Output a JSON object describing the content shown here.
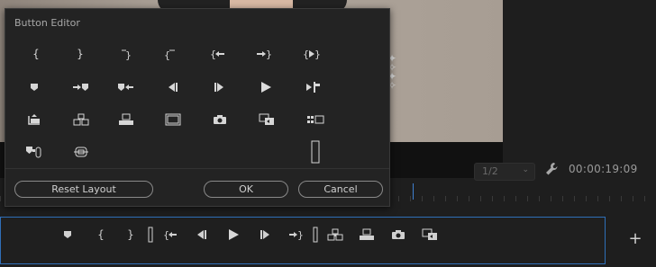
{
  "dialog": {
    "title": "Button Editor",
    "buttons": {
      "reset_layout": "Reset Layout",
      "ok": "OK",
      "cancel": "Cancel"
    },
    "grid_icons": [
      [
        "mark-in-icon",
        "mark-out-icon",
        "clear-in-icon",
        "clear-out-icon",
        "go-to-in-icon",
        "go-to-out-icon",
        "play-in-to-out-icon"
      ],
      [
        "add-marker-icon",
        "go-to-next-marker-icon",
        "go-to-previous-marker-icon",
        "step-back-icon",
        "step-forward-icon",
        "play-icon",
        "play-around-icon"
      ],
      [
        "lift-icon",
        "insert-icon",
        "overwrite-icon",
        "safe-margins-icon",
        "export-frame-icon",
        "trim-monitor-icon",
        "multi-camera-icon"
      ],
      [
        "proxy-icon",
        "vr-video-icon",
        "spacer-icon"
      ]
    ]
  },
  "monitor": {
    "fit_value": "1/2",
    "timecode": "00:00:19:09"
  },
  "transport": {
    "icons": [
      "add-marker-icon",
      "mark-in-icon",
      "mark-out-icon",
      "spacer-icon",
      "go-to-in-icon",
      "step-back-icon",
      "play-icon",
      "step-forward-icon",
      "go-to-out-icon",
      "spacer-icon",
      "insert-icon",
      "overwrite-icon",
      "export-frame-icon",
      "trim-monitor-icon"
    ]
  },
  "colors": {
    "accent": "#2f6fb8",
    "playhead": "#3f7fd0"
  }
}
